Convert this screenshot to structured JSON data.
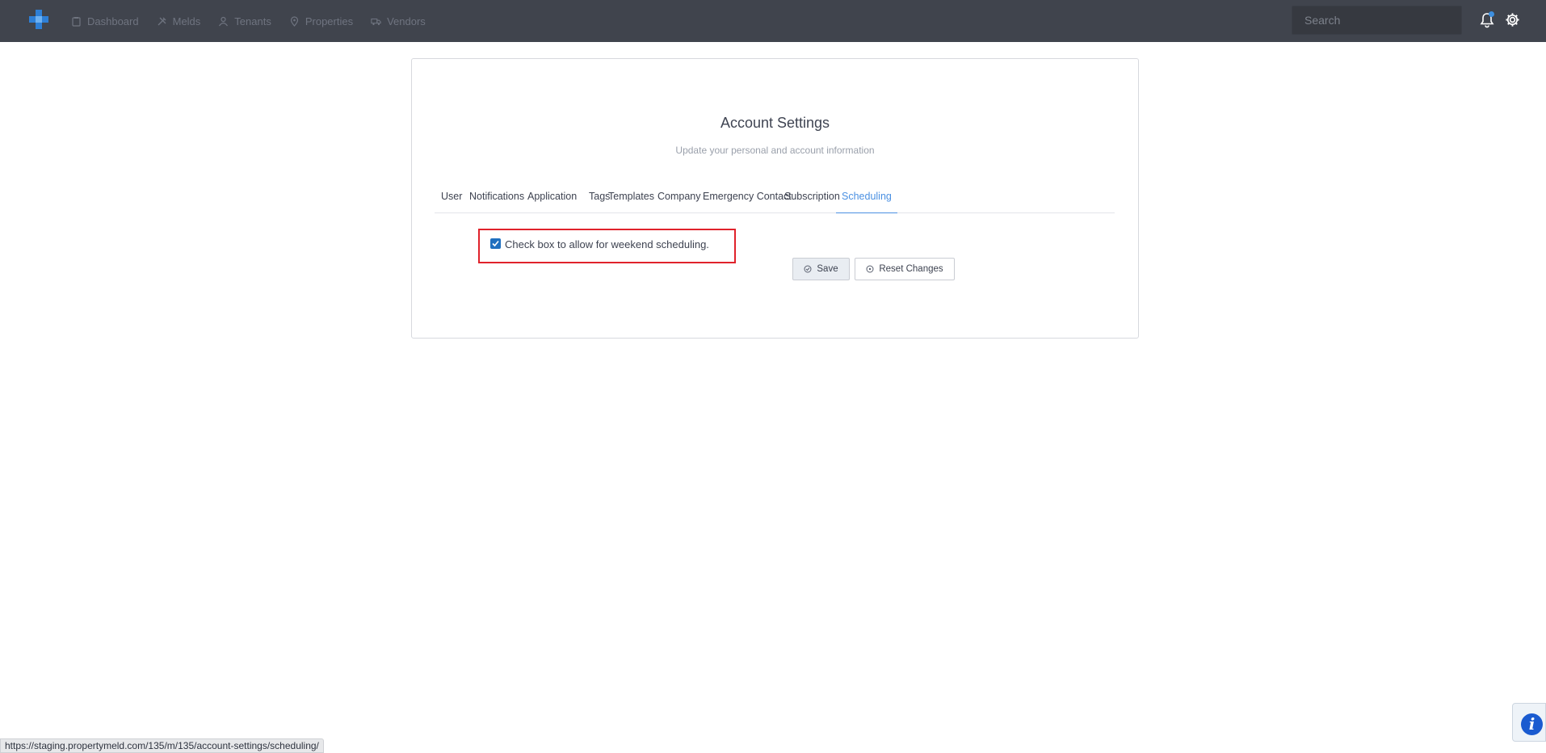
{
  "nav": {
    "items": [
      {
        "label": "Dashboard",
        "icon": "clipboard-icon"
      },
      {
        "label": "Melds",
        "icon": "tools-icon"
      },
      {
        "label": "Tenants",
        "icon": "person-icon"
      },
      {
        "label": "Properties",
        "icon": "map-pin-icon"
      },
      {
        "label": "Vendors",
        "icon": "truck-icon"
      }
    ],
    "search_placeholder": "Search"
  },
  "page": {
    "title": "Account Settings",
    "subtitle": "Update your personal and account information"
  },
  "tabs": [
    {
      "label": "User"
    },
    {
      "label": "Notifications"
    },
    {
      "label": "Application"
    },
    {
      "label": "Tags"
    },
    {
      "label": "Templates"
    },
    {
      "label": "Company"
    },
    {
      "label": "Emergency Contact"
    },
    {
      "label": "Subscription"
    },
    {
      "label": "Scheduling",
      "active": true
    }
  ],
  "scheduling": {
    "weekend_label": "Check box to allow for weekend scheduling.",
    "weekend_checked": true
  },
  "buttons": {
    "save": "Save",
    "reset": "Reset Changes"
  },
  "status_url": "https://staging.propertymeld.com/135/m/135/account-settings/scheduling/",
  "colors": {
    "topbar": "#40444d",
    "accent": "#4a90e2",
    "highlight_border": "#e0222b",
    "checkbox": "#1f6fbf"
  }
}
